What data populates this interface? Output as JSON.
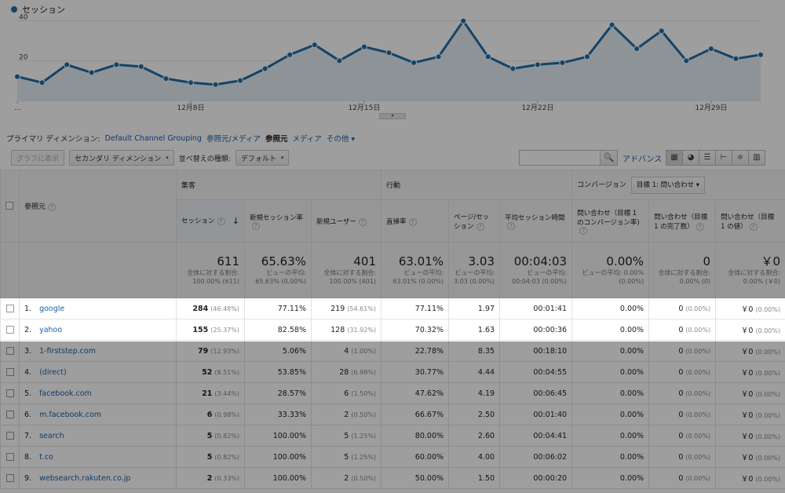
{
  "chart_data": {
    "type": "line",
    "series": [
      {
        "name": "セッション",
        "values": [
          12,
          9,
          18,
          14,
          18,
          17,
          11,
          9,
          8,
          10,
          16,
          23,
          28,
          20,
          27,
          24,
          19,
          22,
          40,
          22,
          16,
          18,
          19,
          22,
          38,
          26,
          35,
          20,
          26,
          21,
          23
        ]
      }
    ],
    "x_ticks": [
      "...",
      "12月8日",
      "12月15日",
      "12月22日",
      "12月29日"
    ],
    "y_ticks": [
      20,
      40
    ],
    "ylim": [
      0,
      45
    ],
    "grid": true,
    "color": "#1f6fa8"
  },
  "legend_label": "セッション",
  "dimension_bar": {
    "label": "プライマリ ディメンション:",
    "items": [
      "Default Channel Grouping",
      "参照元/メディア",
      "参照元",
      "メディア",
      "その他"
    ],
    "other_caret": "▾"
  },
  "toolbar": {
    "plot_button": "グラフに表示",
    "secondary_dimension": "セカンダリ ディメンション",
    "sort_label": "並べ替えの種類:",
    "sort_value": "デフォルト",
    "caret": "▾",
    "advanced": "アドバンス",
    "search_icon": "🔍"
  },
  "table": {
    "source_header": "参照元",
    "groups": [
      "集客",
      "行動",
      "コンバージョン"
    ],
    "goal_select": "目標 1: 問い合わせ",
    "metric_headers": [
      "セッション",
      "新規セッション率",
      "新規ユーザー",
      "直帰率",
      "ページ/セッション",
      "平均セッション時間",
      "問い合わせ（目標 1 のコンバージョン率)",
      "問い合わせ（目標 1 の完了数）",
      "問い合わせ（目標 1 の値）"
    ],
    "sort_arrow": "↓",
    "help": "?",
    "totals": [
      {
        "big": "611",
        "sub": "全体に対する割合: 100.00% (611)"
      },
      {
        "big": "65.63%",
        "sub": "ビューの平均: 65.63% (0.00%)"
      },
      {
        "big": "401",
        "sub": "全体に対する割合: 100.00% (401)"
      },
      {
        "big": "63.01%",
        "sub": "ビューの平均: 63.01% (0.00%)"
      },
      {
        "big": "3.03",
        "sub": "ビューの平均: 3.03 (0.00%)"
      },
      {
        "big": "00:04:03",
        "sub": "ビューの平均: 00:04:03 (0.00%)"
      },
      {
        "big": "0.00%",
        "sub": "ビューの平均: 0.00% (0.00%)"
      },
      {
        "big": "0",
        "sub": "全体に対する割合: 0.00% (0)"
      },
      {
        "big": "￥0",
        "sub": "全体に対する割合: 0.00% (￥0)"
      }
    ],
    "rows": [
      {
        "n": "1.",
        "src": "google",
        "sessions": "284",
        "sessions_pct": "(46.48%)",
        "new_rate": "77.11%",
        "new_users": "219",
        "new_users_pct": "(54.61%)",
        "bounce": "77.11%",
        "pps": "1.97",
        "avg": "00:01:41",
        "conv": "0.00%",
        "done": "0",
        "done_pct": "(0.00%)",
        "val": "￥0",
        "val_pct": "(0.00%)"
      },
      {
        "n": "2.",
        "src": "yahoo",
        "sessions": "155",
        "sessions_pct": "(25.37%)",
        "new_rate": "82.58%",
        "new_users": "128",
        "new_users_pct": "(31.92%)",
        "bounce": "70.32%",
        "pps": "1.63",
        "avg": "00:00:36",
        "conv": "0.00%",
        "done": "0",
        "done_pct": "(0.00%)",
        "val": "￥0",
        "val_pct": "(0.00%)"
      },
      {
        "n": "3.",
        "src": "1-firststep.com",
        "sessions": "79",
        "sessions_pct": "(12.93%)",
        "new_rate": "5.06%",
        "new_users": "4",
        "new_users_pct": "(1.00%)",
        "bounce": "22.78%",
        "pps": "8.35",
        "avg": "00:18:10",
        "conv": "0.00%",
        "done": "0",
        "done_pct": "(0.00%)",
        "val": "￥0",
        "val_pct": "(0.00%)"
      },
      {
        "n": "4.",
        "src": "(direct)",
        "sessions": "52",
        "sessions_pct": "(8.51%)",
        "new_rate": "53.85%",
        "new_users": "28",
        "new_users_pct": "(6.98%)",
        "bounce": "30.77%",
        "pps": "4.44",
        "avg": "00:04:55",
        "conv": "0.00%",
        "done": "0",
        "done_pct": "(0.00%)",
        "val": "￥0",
        "val_pct": "(0.00%)"
      },
      {
        "n": "5.",
        "src": "facebook.com",
        "sessions": "21",
        "sessions_pct": "(3.44%)",
        "new_rate": "28.57%",
        "new_users": "6",
        "new_users_pct": "(1.50%)",
        "bounce": "47.62%",
        "pps": "4.19",
        "avg": "00:06:45",
        "conv": "0.00%",
        "done": "0",
        "done_pct": "(0.00%)",
        "val": "￥0",
        "val_pct": "(0.00%)"
      },
      {
        "n": "6.",
        "src": "m.facebook.com",
        "sessions": "6",
        "sessions_pct": "(0.98%)",
        "new_rate": "33.33%",
        "new_users": "2",
        "new_users_pct": "(0.50%)",
        "bounce": "66.67%",
        "pps": "2.50",
        "avg": "00:01:40",
        "conv": "0.00%",
        "done": "0",
        "done_pct": "(0.00%)",
        "val": "￥0",
        "val_pct": "(0.00%)"
      },
      {
        "n": "7.",
        "src": "search",
        "sessions": "5",
        "sessions_pct": "(0.82%)",
        "new_rate": "100.00%",
        "new_users": "5",
        "new_users_pct": "(1.25%)",
        "bounce": "80.00%",
        "pps": "2.60",
        "avg": "00:04:41",
        "conv": "0.00%",
        "done": "0",
        "done_pct": "(0.00%)",
        "val": "￥0",
        "val_pct": "(0.00%)"
      },
      {
        "n": "8.",
        "src": "t.co",
        "sessions": "5",
        "sessions_pct": "(0.82%)",
        "new_rate": "100.00%",
        "new_users": "5",
        "new_users_pct": "(1.25%)",
        "bounce": "60.00%",
        "pps": "4.00",
        "avg": "00:06:02",
        "conv": "0.00%",
        "done": "0",
        "done_pct": "(0.00%)",
        "val": "￥0",
        "val_pct": "(0.00%)"
      },
      {
        "n": "9.",
        "src": "websearch.rakuten.co.jp",
        "sessions": "2",
        "sessions_pct": "(0.33%)",
        "new_rate": "100.00%",
        "new_users": "2",
        "new_users_pct": "(0.50%)",
        "bounce": "50.00%",
        "pps": "1.50",
        "avg": "00:00:20",
        "conv": "0.00%",
        "done": "0",
        "done_pct": "(0.00%)",
        "val": "￥0",
        "val_pct": "(0.00%)"
      }
    ]
  }
}
